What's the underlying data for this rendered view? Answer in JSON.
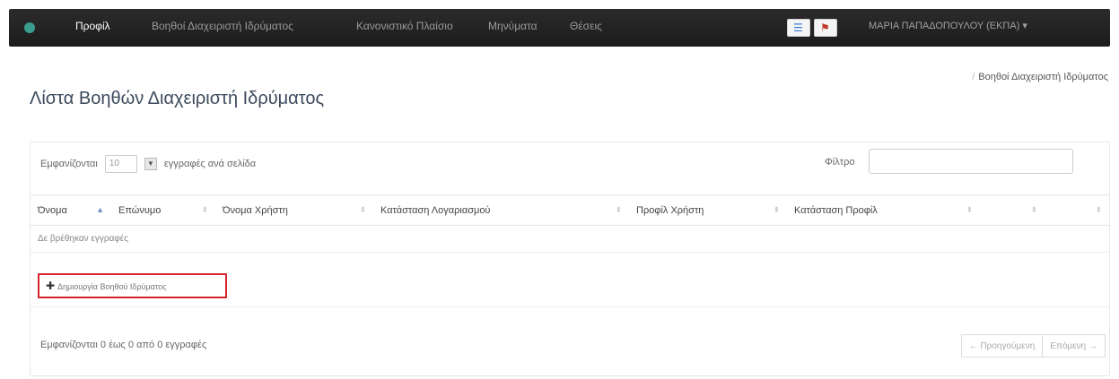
{
  "navbar": {
    "items": [
      {
        "label": "Προφίλ",
        "active": true
      },
      {
        "label": "Βοηθοί Διαχειριστή Ιδρύματος",
        "active": false
      },
      {
        "label": "Κανονιστικό Πλαίσιο",
        "active": false
      },
      {
        "label": "Μηνύματα",
        "active": false
      },
      {
        "label": "Θέσεις",
        "active": false
      }
    ],
    "user_menu": "ΜΑΡΙΑ ΠΑΠΑΔΟΠΟΥΛΟΥ (ΕΚΠΑ) ▾",
    "languages": [
      {
        "icon": "list-icon",
        "glyph": "☰",
        "color": "#3a7bd5"
      },
      {
        "icon": "flag-icon",
        "glyph": "⚑",
        "color": "#c0392b"
      }
    ]
  },
  "breadcrumb": {
    "separator": "/",
    "current": "Βοηθοί Διαχειριστή Ιδρύματος"
  },
  "page": {
    "title": "Λίστα Βοηθών Διαχειριστή Ιδρύματος"
  },
  "table": {
    "length_prefix": "Εμφανίζονται",
    "length_value": "10",
    "length_suffix": "εγγραφές ανά σελίδα",
    "filter_label": "Φίλτρο",
    "columns": [
      "Όνομα",
      "Επώνυμο",
      "Όνομα Χρήστη",
      "Κατάσταση Λογαριασμού",
      "Προφίλ Χρήστη",
      "Κατάσταση Προφίλ",
      "",
      ""
    ],
    "empty_message": "Δε βρέθηκαν εγγραφές",
    "create_button": "Δημιουργία Βοηθού Ιδρύματος",
    "info": "Εμφανίζονται 0 έως 0 από 0 εγγραφές",
    "prev_label": "← Προηγούμενη",
    "next_label": "Επόμενη →"
  },
  "colors": {
    "navbar": "#222222",
    "highlight": "#d9232b",
    "title": "#3b4a5c"
  }
}
